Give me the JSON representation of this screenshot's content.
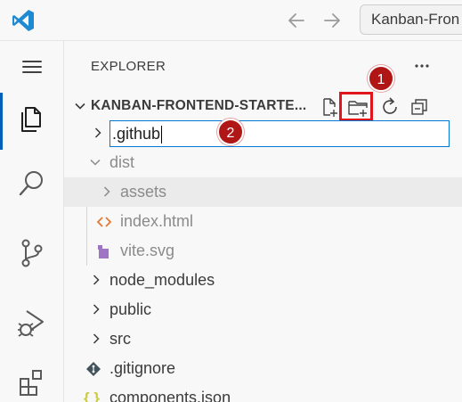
{
  "titlebar": {
    "search_text": "Kanban-Fron"
  },
  "sidebar": {
    "title": "EXPLORER",
    "folder_name": "KANBAN-FRONTEND-STARTE...",
    "rename_value": ".github",
    "tree": [
      {
        "label": "dist",
        "type": "folder",
        "state": "expanded"
      },
      {
        "label": "assets",
        "type": "folder",
        "state": "collapsed"
      },
      {
        "label": "index.html",
        "type": "file",
        "icon": "html-icon"
      },
      {
        "label": "vite.svg",
        "type": "file",
        "icon": "vite-icon"
      },
      {
        "label": "node_modules",
        "type": "folder",
        "state": "collapsed"
      },
      {
        "label": "public",
        "type": "folder",
        "state": "collapsed"
      },
      {
        "label": "src",
        "type": "folder",
        "state": "collapsed"
      },
      {
        "label": ".gitignore",
        "type": "file",
        "icon": "git-icon"
      },
      {
        "label": "components.json",
        "type": "file",
        "icon": "json-icon"
      }
    ]
  },
  "annotations": {
    "badge_1": "1",
    "badge_2": "2",
    "highlight_color": "#e0141c",
    "badge_color": "#b01616"
  },
  "colors": {
    "accent": "#005fb8",
    "input_border": "#0078d4"
  }
}
